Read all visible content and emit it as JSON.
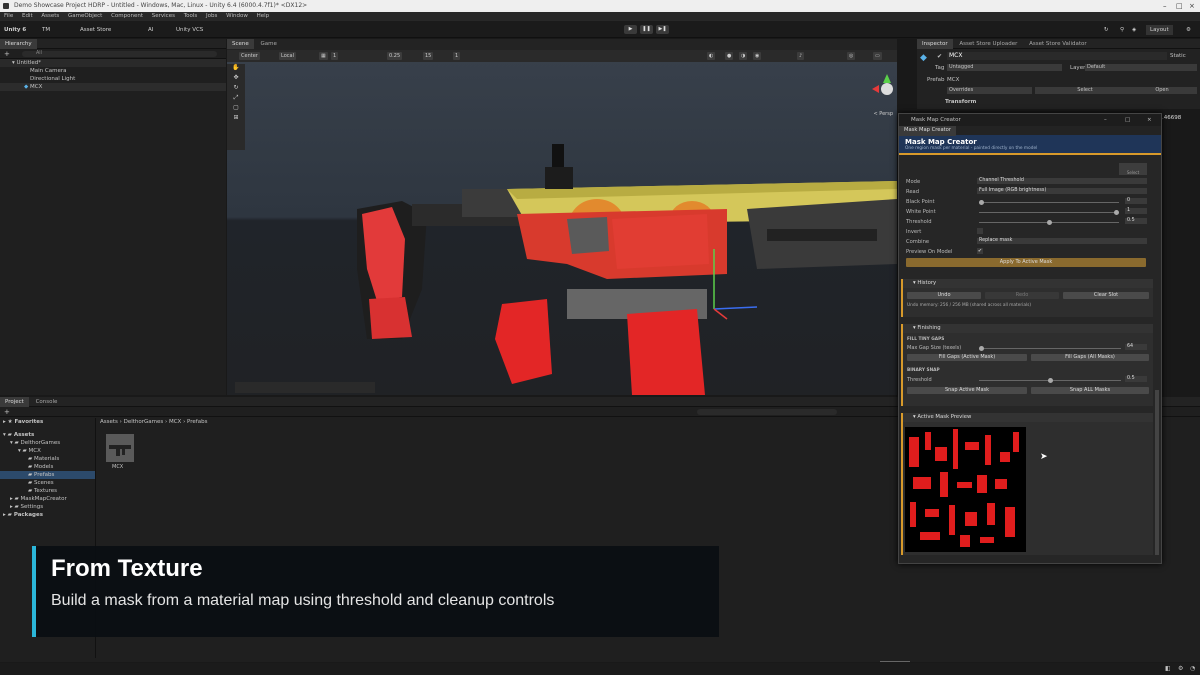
{
  "window": {
    "title": "Demo Showcase Project HDRP - Untitled - Windows, Mac, Linux - Unity 6.4 (6000.4.7f1)* <DX12>"
  },
  "menu": [
    "File",
    "Edit",
    "Assets",
    "GameObject",
    "Component",
    "Services",
    "Tools",
    "Jobs",
    "Window",
    "Help"
  ],
  "toolbar": {
    "unity": "Unity 6",
    "account": "TM",
    "asset_store": "Asset Store",
    "ai": "AI",
    "vcs": "Unity VCS",
    "layout": "Layout"
  },
  "hierarchy": {
    "tab": "Hierarchy",
    "search_placeholder": "All",
    "scene": "Untitled*",
    "items": [
      "Main Camera",
      "Directional Light",
      "MCX"
    ]
  },
  "scene_view": {
    "tabs": [
      "Scene",
      "Game"
    ],
    "pivot": "Center",
    "space": "Local",
    "grid": "1",
    "snap1": "0.25",
    "snap2": "15",
    "snap3": "1",
    "persp": "< Persp"
  },
  "inspector": {
    "tabs": [
      "Inspector",
      "Asset Store Uploader",
      "Asset Store Validator"
    ],
    "object": "MCX",
    "static": "Static",
    "tag_label": "Tag",
    "tag": "Untagged",
    "layer_label": "Layer",
    "layer": "Default",
    "prefab_label": "Prefab",
    "prefab": "MCX",
    "overrides": "Overrides",
    "select": "Select",
    "open": "Open",
    "transform": "Transform",
    "value": ".46698"
  },
  "mask_creator": {
    "window_title": "Mask Map Creator",
    "tab": "Mask Map Creator",
    "header": "Mask Map Creator",
    "subheader": "One region mask per material - painted directly on the model",
    "select_tag": "Select",
    "fields": {
      "mode_label": "Mode",
      "mode": "Channel Threshold",
      "read_label": "Read",
      "read": "Full Image (RGB brightness)",
      "black_label": "Black Point",
      "black": "0",
      "white_label": "White Point",
      "white": "1",
      "threshold_label": "Threshold",
      "threshold": "0.5",
      "invert_label": "Invert",
      "combine_label": "Combine",
      "combine": "Replace mask",
      "preview_label": "Preview On Model"
    },
    "apply": "Apply To Active Mask",
    "history": {
      "title": "History",
      "undo": "Undo",
      "redo": "Redo",
      "clear": "Clear Slot",
      "memory": "Undo memory: 256 / 256 MB (shared across all materials)"
    },
    "finishing": {
      "title": "Finishing",
      "fill_title": "FILL TINY GAPS",
      "gap_label": "Max Gap Size (texels)",
      "gap": "64",
      "fill_active": "Fill Gaps (Active Mask)",
      "fill_all": "Fill Gaps (All Masks)",
      "snap_title": "BINARY SNAP",
      "snap_label": "Threshold",
      "snap_value": "0.5",
      "snap_active": "Snap Active Mask",
      "snap_all": "Snap ALL Masks"
    },
    "preview": {
      "title": "Active Mask Preview"
    },
    "slider_levels": {
      "black": 0.0,
      "white": 1.0,
      "threshold": 0.5,
      "gap": 0.0,
      "snap": 0.5
    }
  },
  "project": {
    "tabs": [
      "Project",
      "Console"
    ],
    "breadcrumb": [
      "Assets",
      "DelthorGames",
      "MCX",
      "Prefabs"
    ],
    "tree": [
      "Favorites",
      "Assets",
      "DelthorGames",
      "MCX",
      "Materials",
      "Models",
      "Prefabs",
      "Scenes",
      "Textures",
      "MaskMapCreator",
      "Settings",
      "Packages"
    ],
    "asset": "MCX"
  },
  "caption": {
    "title": "From Texture",
    "subtitle": "Build a mask from a material map using threshold and cleanup controls"
  },
  "colors": {
    "accent": "#2bb6d9",
    "orange": "#d89a2b",
    "mask_red": "#e01d1d",
    "header_blue": "#1f3558"
  }
}
